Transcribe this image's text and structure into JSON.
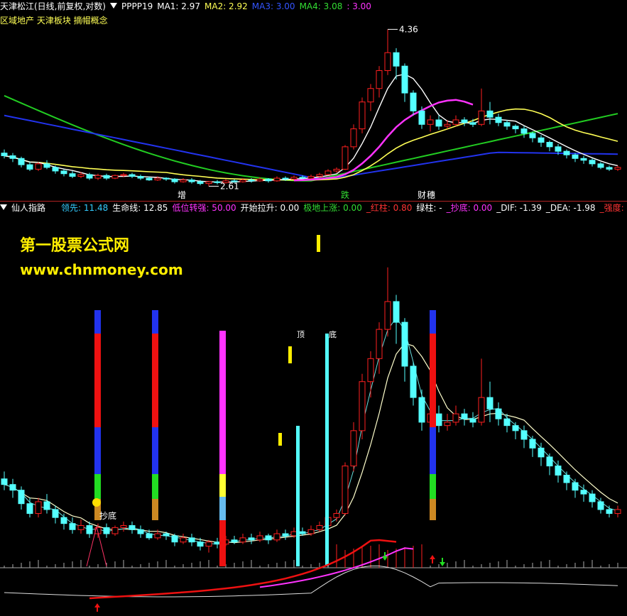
{
  "top_panel": {
    "title": "天津松江(日线,前复权,对数)",
    "indicator": "PPPP19",
    "ma": [
      {
        "label": "MA1: 2.97",
        "color": "#ffffff"
      },
      {
        "label": "MA2: 2.92",
        "color": "#ffff55"
      },
      {
        "label": "MA3: 3.00",
        "color": "#3355ff"
      },
      {
        "label": "MA4: 3.08",
        "color": "#33dd33"
      },
      {
        "label": ": 3.00",
        "color": "#ff33ff"
      }
    ],
    "subtitle": "区域地产 天津板块 摘帽概念",
    "high_label": "4.36",
    "low_label": "2.61",
    "markers": [
      {
        "text": "增",
        "color": "#ffffff"
      },
      {
        "text": "跌",
        "color": "#33dd33"
      },
      {
        "text": "财",
        "color": "#ffffff"
      },
      {
        "text": "穗",
        "color": "#ffffff"
      }
    ]
  },
  "bottom_panel": {
    "title": "仙人指路",
    "fields": [
      {
        "label": "领先: ",
        "value": "11.48",
        "color": "#33ccff"
      },
      {
        "label": "生命线: ",
        "value": "12.85",
        "color": "#ffffff"
      },
      {
        "label": "低位转强: ",
        "value": "50.00",
        "color": "#ff33ff"
      },
      {
        "label": "开始拉升: ",
        "value": "0.00",
        "color": "#ffffff"
      },
      {
        "label": "极地上涨: ",
        "value": "0.00",
        "color": "#33dd33"
      },
      {
        "label": "_红柱: ",
        "value": "0.80",
        "color": "#ff3333"
      },
      {
        "label": "绿柱: ",
        "value": "-",
        "color": "#ffffff"
      },
      {
        "label": "_抄底: ",
        "value": "0.00",
        "color": "#ff33ff"
      },
      {
        "label": "_DIF: ",
        "value": "-1.39",
        "color": "#ffffff"
      },
      {
        "label": "_DEA: ",
        "value": "-1.98",
        "color": "#ffffff"
      },
      {
        "label": "_强度: ",
        "value": "-",
        "color": "#ff3333"
      }
    ],
    "annotations": {
      "chaodi": "抄底",
      "di1": "顶",
      "di2": "底"
    }
  },
  "watermark": {
    "line1": "第一股票公式网",
    "line2": "www.chnmoney.com"
  },
  "colors": {
    "up": "#ff2020",
    "down": "#54ffff",
    "ma1": "#ffffff",
    "ma2": "#ffff55",
    "ma3": "#2233ee",
    "ma4": "#22cc22",
    "ma5": "#ff33ff"
  },
  "chart_data": {
    "type": "candlestick",
    "price_high": 4.36,
    "price_low": 2.61,
    "price_candles": [
      [
        2.98,
        2.95,
        3.02,
        2.92
      ],
      [
        2.95,
        2.92,
        2.98,
        2.88
      ],
      [
        2.92,
        2.85,
        2.94,
        2.82
      ],
      [
        2.85,
        2.8,
        2.88,
        2.78
      ],
      [
        2.8,
        2.86,
        2.88,
        2.78
      ],
      [
        2.86,
        2.82,
        2.9,
        2.8
      ],
      [
        2.82,
        2.78,
        2.84,
        2.75
      ],
      [
        2.78,
        2.75,
        2.8,
        2.72
      ],
      [
        2.75,
        2.72,
        2.78,
        2.7
      ],
      [
        2.72,
        2.74,
        2.77,
        2.7
      ],
      [
        2.74,
        2.7,
        2.76,
        2.68
      ],
      [
        2.7,
        2.73,
        2.75,
        2.68
      ],
      [
        2.73,
        2.7,
        2.75,
        2.68
      ],
      [
        2.7,
        2.73,
        2.74,
        2.69
      ],
      [
        2.73,
        2.74,
        2.76,
        2.71
      ],
      [
        2.74,
        2.72,
        2.76,
        2.7
      ],
      [
        2.72,
        2.7,
        2.74,
        2.68
      ],
      [
        2.7,
        2.68,
        2.72,
        2.67
      ],
      [
        2.68,
        2.7,
        2.72,
        2.67
      ],
      [
        2.7,
        2.69,
        2.71,
        2.67
      ],
      [
        2.69,
        2.66,
        2.7,
        2.64
      ],
      [
        2.66,
        2.68,
        2.7,
        2.65
      ],
      [
        2.68,
        2.66,
        2.7,
        2.64
      ],
      [
        2.66,
        2.64,
        2.68,
        2.62
      ],
      [
        2.64,
        2.66,
        2.67,
        2.61
      ],
      [
        2.66,
        2.65,
        2.68,
        2.63
      ],
      [
        2.65,
        2.67,
        2.69,
        2.64
      ],
      [
        2.67,
        2.66,
        2.69,
        2.65
      ],
      [
        2.66,
        2.68,
        2.7,
        2.65
      ],
      [
        2.68,
        2.67,
        2.7,
        2.65
      ],
      [
        2.67,
        2.69,
        2.71,
        2.66
      ],
      [
        2.69,
        2.67,
        2.7,
        2.65
      ],
      [
        2.67,
        2.7,
        2.72,
        2.66
      ],
      [
        2.7,
        2.69,
        2.72,
        2.67
      ],
      [
        2.69,
        2.71,
        2.73,
        2.68
      ],
      [
        2.71,
        2.7,
        2.73,
        2.69
      ],
      [
        2.7,
        2.72,
        2.74,
        2.69
      ],
      [
        2.72,
        2.74,
        2.76,
        2.71
      ],
      [
        2.74,
        2.78,
        2.8,
        2.73
      ],
      [
        2.78,
        2.8,
        2.82,
        2.76
      ],
      [
        2.8,
        3.05,
        3.07,
        2.79
      ],
      [
        3.05,
        3.25,
        3.3,
        3.02
      ],
      [
        3.25,
        3.55,
        3.6,
        3.2
      ],
      [
        3.55,
        3.7,
        3.75,
        3.45
      ],
      [
        3.7,
        3.9,
        3.95,
        3.6
      ],
      [
        3.9,
        4.1,
        4.36,
        3.85
      ],
      [
        4.1,
        3.95,
        4.15,
        3.8
      ],
      [
        3.95,
        3.65,
        3.98,
        3.55
      ],
      [
        3.65,
        3.45,
        3.68,
        3.4
      ],
      [
        3.45,
        3.3,
        3.5,
        3.25
      ],
      [
        3.3,
        3.35,
        3.4,
        3.22
      ],
      [
        3.35,
        3.28,
        3.4,
        3.24
      ],
      [
        3.28,
        3.3,
        3.35,
        3.25
      ],
      [
        3.3,
        3.35,
        3.4,
        3.28
      ],
      [
        3.35,
        3.32,
        3.38,
        3.28
      ],
      [
        3.32,
        3.3,
        3.36,
        3.27
      ],
      [
        3.3,
        3.45,
        3.7,
        3.28
      ],
      [
        3.45,
        3.38,
        3.55,
        3.3
      ],
      [
        3.38,
        3.32,
        3.42,
        3.28
      ],
      [
        3.32,
        3.28,
        3.35,
        3.24
      ],
      [
        3.28,
        3.25,
        3.3,
        3.2
      ],
      [
        3.25,
        3.2,
        3.28,
        3.15
      ],
      [
        3.2,
        3.15,
        3.22,
        3.1
      ],
      [
        3.15,
        3.1,
        3.18,
        3.05
      ],
      [
        3.1,
        3.05,
        3.12,
        3.0
      ],
      [
        3.05,
        3.0,
        3.08,
        2.96
      ],
      [
        3.0,
        2.96,
        3.02,
        2.92
      ],
      [
        2.96,
        2.92,
        2.98,
        2.88
      ],
      [
        2.92,
        2.9,
        2.95,
        2.86
      ],
      [
        2.9,
        2.86,
        2.92,
        2.83
      ],
      [
        2.86,
        2.82,
        2.88,
        2.8
      ],
      [
        2.82,
        2.8,
        2.84,
        2.78
      ],
      [
        2.8,
        2.82,
        2.84,
        2.78
      ]
    ]
  }
}
